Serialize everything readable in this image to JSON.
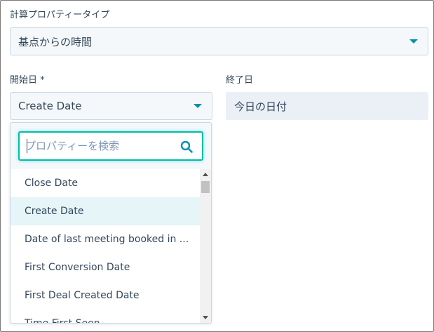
{
  "calc_type": {
    "label": "計算プロパティータイプ",
    "value": "基点からの時間"
  },
  "start_date": {
    "label": "開始日 *",
    "value": "Create Date"
  },
  "end_date": {
    "label": "終了日",
    "value": "今日の日付"
  },
  "dropdown": {
    "search_placeholder": "プロパティーを検索",
    "items": [
      "Close Date",
      "Create Date",
      "Date of last meeting booked in ...",
      "First Conversion Date",
      "First Deal Created Date",
      "Time First Seen"
    ],
    "hovered_index": 1
  },
  "colors": {
    "accent": "#0091ae",
    "focus": "#00bda5",
    "hover": "#e5f5f8",
    "text": "#33475b"
  }
}
